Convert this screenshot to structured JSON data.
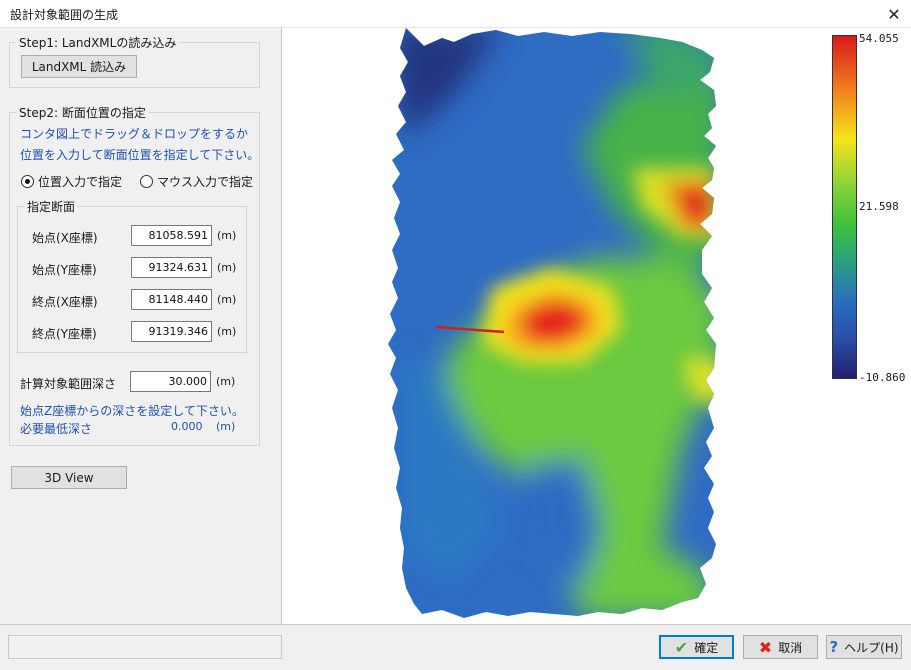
{
  "window": {
    "title": "設計対象範囲の生成"
  },
  "step1": {
    "legend": "Step1: LandXMLの読み込み",
    "load_button": "LandXML 読込み"
  },
  "step2": {
    "legend": "Step2: 断面位置の指定",
    "instruction_line1": "コンタ図上でドラッグ＆ドロップをするか",
    "instruction_line2": "位置を入力して断面位置を指定して下さい。",
    "radio_position": "位置入力で指定",
    "radio_mouse": "マウス入力で指定",
    "section_legend": "指定断面",
    "start_x": {
      "label": "始点(X座標)",
      "value": "81058.591",
      "unit": "(m)"
    },
    "start_y": {
      "label": "始点(Y座標)",
      "value": "91324.631",
      "unit": "(m)"
    },
    "end_x": {
      "label": "終点(X座標)",
      "value": "81148.440",
      "unit": "(m)"
    },
    "end_y": {
      "label": "終点(Y座標)",
      "value": "91319.346",
      "unit": "(m)"
    },
    "depth": {
      "label": "計算対象範囲深さ",
      "value": "30.000",
      "unit": "(m)"
    },
    "depth_note": "始点Z座標からの深さを設定して下さい。",
    "min_depth_label": "必要最低深さ",
    "min_depth_value": "0.000",
    "min_depth_unit": "(m)"
  },
  "view3d_button": "3D View",
  "colorbar": {
    "max": "54.055",
    "mid": "21.598",
    "min": "-10.860",
    "colors": [
      "#d7191c",
      "#f4e41a",
      "#3fc23a",
      "#2a6dc0",
      "#232070"
    ]
  },
  "buttons": {
    "ok": "確定",
    "cancel": "取消",
    "help": "ヘルプ(H)"
  },
  "icons": {
    "ok": "check-icon",
    "cancel": "cross-icon",
    "help": "question-icon",
    "close": "close-icon"
  }
}
